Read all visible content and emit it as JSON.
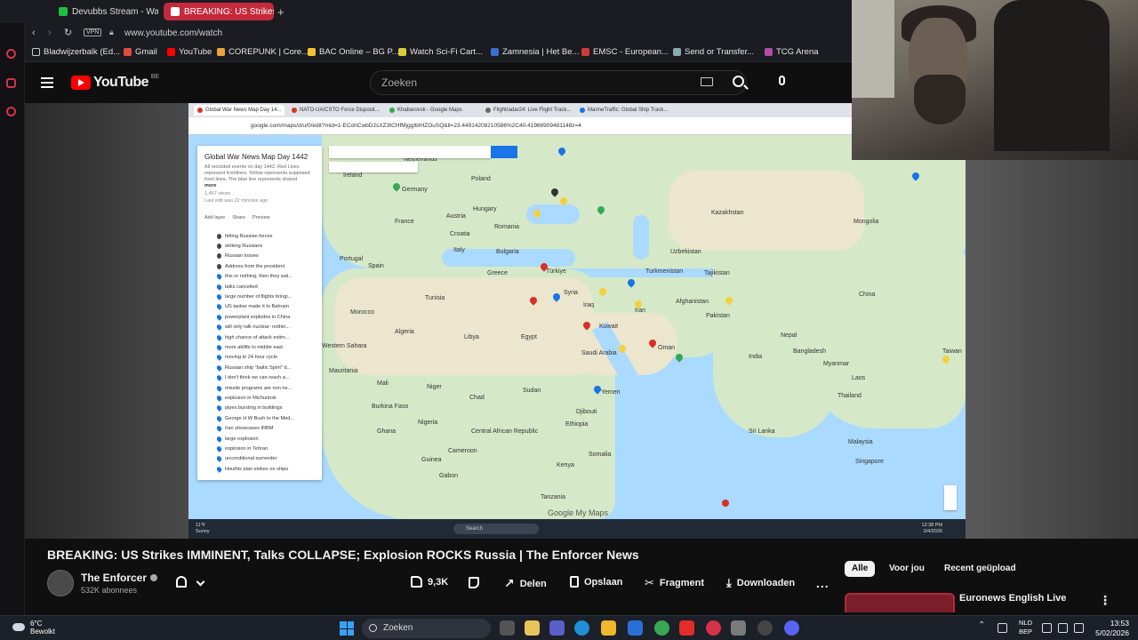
{
  "browser": {
    "tabs": [
      {
        "label": "Devubbs Stream - Wat",
        "active": false
      },
      {
        "label": "BREAKING: US Strikes",
        "active": true
      }
    ],
    "url": "www.youtube.com/watch",
    "vpn_label": "VPN",
    "bookmarks": [
      "Bladwijzerbalk (Ed...",
      "Gmail",
      "YouTube",
      "COREPUNK | Core...",
      "BAC Online – BG P...",
      "Watch Sci-Fi Cart...",
      "Zamnesia | Het Be...",
      "EMSC - European...",
      "Send or Transfer...",
      "TCG Arena"
    ]
  },
  "youtube": {
    "logo_text": "YouTube",
    "country_code": "BE",
    "search_placeholder": "Zoeken"
  },
  "video_content": {
    "inner_tabs": [
      "Global War News Map Day 14...",
      "NATO-UA/CSTO Force Disposit...",
      "Khabarovsk - Google Maps",
      "Flightradar24: Live Flight Track...",
      "MarineTraffic: Global Ship Track..."
    ],
    "inner_url": "google.com/maps/d/u/0/edit?mid=1-ECohCwbD2sXZ3tCHfMjggIbIHZOuSQ&ll=23.44914208210586%2C40.41966909481148z=4",
    "map_panel": {
      "title": "Global War News Map Day 1442",
      "description": "All recorded events on day 1442. Red Lines represent frontlines. Yellow represents supposed front lines. The blue line represents shared",
      "more": "more",
      "views": "1,467 views",
      "last_edit": "Last edit was 22 minutes ago",
      "actions": [
        "Add layer",
        "Share",
        "Preview"
      ],
      "layers": [
        "hitting Russian forces",
        "striking Russians",
        "Russian losses",
        "Address from the president",
        "this or nothing, then they wal...",
        "talks cancelled",
        "large number of flights bringi...",
        "US tanker made it to Bahrain",
        "powerplant explodes in China",
        "will only talk nuclear- nothin...",
        "high chance of attack estim...",
        "more aklifts to middle east",
        "moving to 24 hour cycle",
        "Russian ship \"baltic Spirit\" d...",
        "I don't think we can reach a...",
        "missile programs are non ne...",
        "explosion in Michurinsk",
        "pipes bursting in buildings",
        "George H W Bush to the Med...",
        "Iran showcases IRBM",
        "large explosion",
        "explosion in Tehran",
        "unconditional surrender",
        "Houthis plan strikes on ships"
      ]
    },
    "map_labels": [
      "Ireland",
      "Netherlands",
      "Germany",
      "Poland",
      "France",
      "Austria",
      "Hungary",
      "Croatia",
      "Romania",
      "Bulgaria",
      "Portugal",
      "Spain",
      "Italy",
      "Greece",
      "Tunisia",
      "Morocco",
      "Algeria",
      "Libya",
      "Egypt",
      "Türkiye",
      "Syria",
      "Iraq",
      "Iran",
      "Kuwait",
      "Saudi Arabia",
      "Yemen",
      "Oman",
      "Sudan",
      "Chad",
      "Niger",
      "Mali",
      "Mauritania",
      "Western Sahara",
      "Burkina Faso",
      "Ghana",
      "Nigeria",
      "Central African Republic",
      "Cameroon",
      "Gabon",
      "Ethiopia",
      "Djibouti",
      "Somalia",
      "Kenya",
      "Tanzania",
      "Kazakhstan",
      "Uzbekistan",
      "Turkmenistan",
      "Tajikistan",
      "Afghanistan",
      "Pakistan",
      "India",
      "Nepal",
      "Bangladesh",
      "Myanmar",
      "Thailand",
      "Laos",
      "Mongolia",
      "China",
      "Taiwan",
      "Sri Lanka",
      "Malaysia",
      "Singapore",
      "Guinea"
    ],
    "map_footer": "Google My Maps",
    "inner_taskbar": {
      "weather_temp": "11°F",
      "weather_desc": "Sunny",
      "search": "Search",
      "time": "12:38 PM",
      "date": "2/4/2026"
    }
  },
  "video_info": {
    "title": "BREAKING: US Strikes IMMINENT, Talks COLLAPSE; Explosion ROCKS Russia | The Enforcer News",
    "channel": "The Enforcer",
    "subscribers": "532K abonnees",
    "likes": "9,3K",
    "actions": [
      "Delen",
      "Opslaan",
      "Fragment",
      "Downloaden"
    ],
    "more": "..."
  },
  "recommendations": {
    "chips": [
      "Alle",
      "Voor jou",
      "Recent geüpload"
    ],
    "active_chip": "Alle",
    "first_title": "Euronews English Live"
  },
  "taskbar": {
    "temperature": "6°C",
    "weather": "Bewolkt",
    "search": "Zoeken",
    "lang_line1": "NLD",
    "lang_line2": "BEP",
    "time": "13:53",
    "date": "5/02/2026"
  },
  "colors": {
    "accent_red": "#ff0000",
    "active_tab": "#c42a3c",
    "map_water": "#aadaff",
    "map_land": "#d5e9c8"
  }
}
